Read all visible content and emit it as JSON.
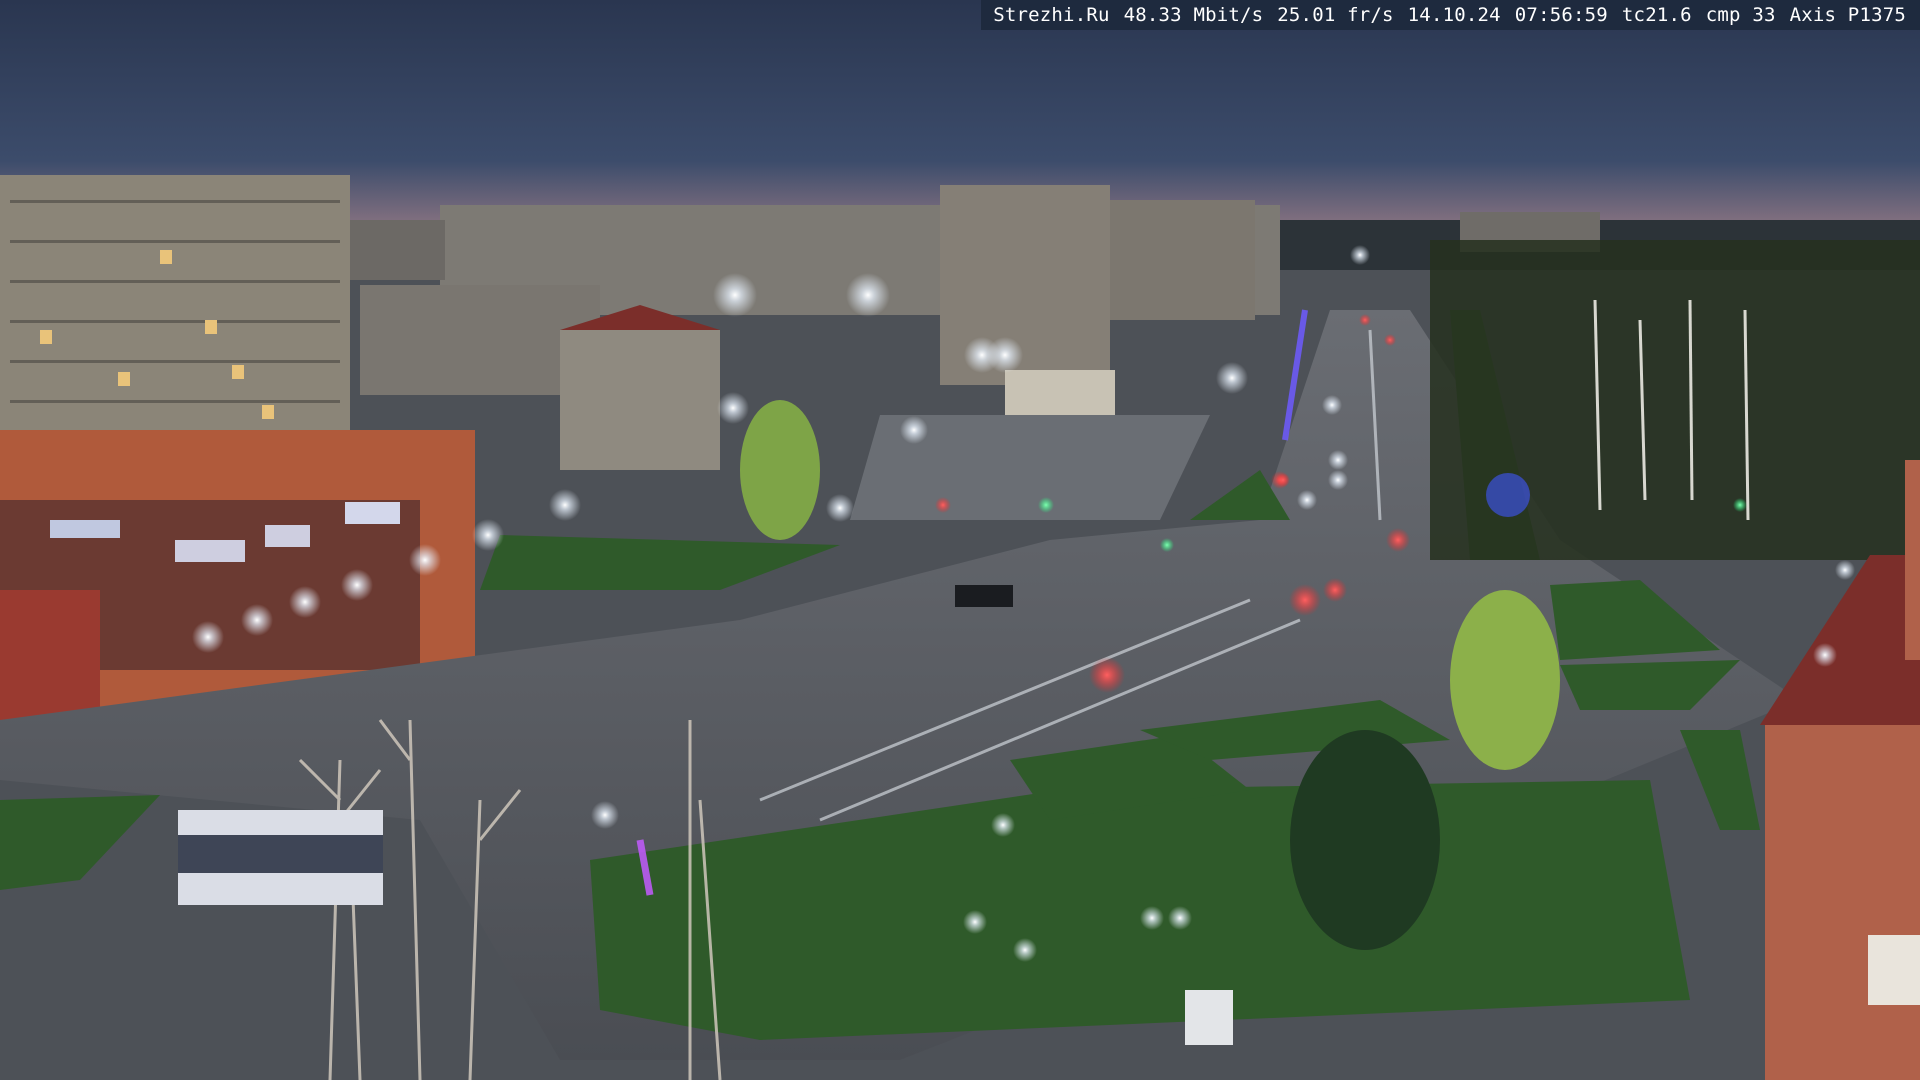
{
  "osd": {
    "site": "Strezhi.Ru",
    "bitrate": "48.33 Mbit/s",
    "fps": "25.01 fr/s",
    "date": "14.10.24",
    "time": "07:56:59",
    "tc": "tc21.6",
    "cmp": "cmp 33",
    "camera_model": "Axis P1375"
  },
  "scene": {
    "colors": {
      "sky_top": "#2a3650",
      "sky_mid": "#3c4c6b",
      "sky_horizon": "#8a7482",
      "asphalt": "#5b5f66",
      "grass": "#2f5a2a",
      "building_panel": "#8b8578",
      "building_brick": "#b55a3a",
      "lamp_glow": "#e9f3ff",
      "tail_light": "#ff3b3b"
    }
  }
}
